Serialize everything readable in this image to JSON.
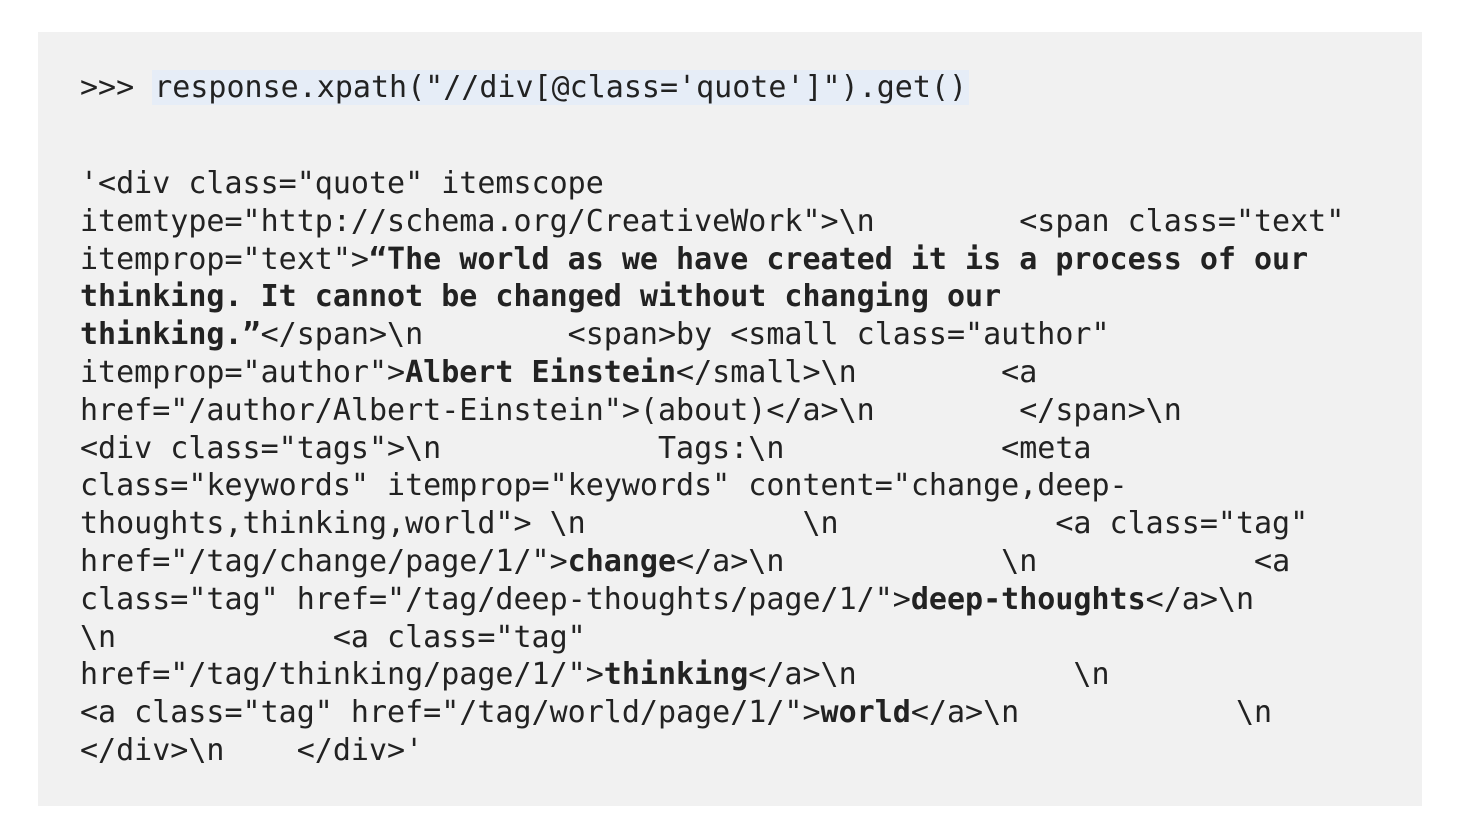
{
  "console": {
    "prompt": ">>> ",
    "command": "response.xpath(\"//div[@class='quote']\").get()"
  },
  "output": {
    "lines": [
      [
        {
          "t": "'<div class=\"quote\" itemscope"
        }
      ],
      [
        {
          "t": "itemtype=\"http://schema.org/CreativeWork\">\\n        <span class=\"text\""
        }
      ],
      [
        {
          "t": "itemprop=\"text\">"
        },
        {
          "t": "“The world as we have created it is a process of our",
          "b": true
        }
      ],
      [
        {
          "t": "thinking. It cannot be changed without changing our",
          "b": true
        }
      ],
      [
        {
          "t": "thinking.”",
          "b": true
        },
        {
          "t": "</span>\\n        <span>by <small class=\"author\""
        }
      ],
      [
        {
          "t": "itemprop=\"author\">"
        },
        {
          "t": "Albert Einstein",
          "b": true
        },
        {
          "t": "</small>\\n        <a"
        }
      ],
      [
        {
          "t": "href=\"/author/Albert-Einstein\">(about)</a>\\n        </span>\\n"
        }
      ],
      [
        {
          "t": "<div class=\"tags\">\\n            Tags:\\n            <meta"
        }
      ],
      [
        {
          "t": "class=\"keywords\" itemprop=\"keywords\" content=\"change,deep-"
        }
      ],
      [
        {
          "t": "thoughts,thinking,world\"> \\n            \\n            <a class=\"tag\""
        }
      ],
      [
        {
          "t": "href=\"/tag/change/page/1/\">"
        },
        {
          "t": "change",
          "b": true
        },
        {
          "t": "</a>\\n            \\n            <a"
        }
      ],
      [
        {
          "t": "class=\"tag\" href=\"/tag/deep-thoughts/page/1/\">"
        },
        {
          "t": "deep-thoughts",
          "b": true
        },
        {
          "t": "</a>\\n"
        }
      ],
      [
        {
          "t": "\\n            <a class=\"tag\""
        }
      ],
      [
        {
          "t": "href=\"/tag/thinking/page/1/\">"
        },
        {
          "t": "thinking",
          "b": true
        },
        {
          "t": "</a>\\n            \\n"
        }
      ],
      [
        {
          "t": "<a class=\"tag\" href=\"/tag/world/page/1/\">"
        },
        {
          "t": "world",
          "b": true
        },
        {
          "t": "</a>\\n            \\n"
        }
      ],
      [
        {
          "t": "</div>\\n    </div>'"
        }
      ]
    ]
  }
}
